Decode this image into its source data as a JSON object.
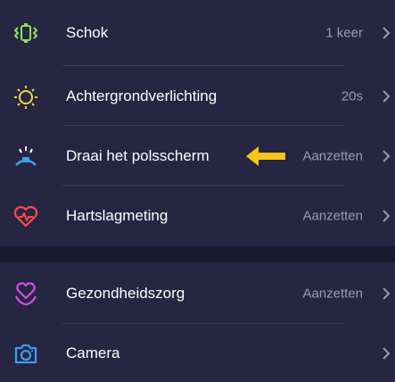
{
  "settings": {
    "group1": [
      {
        "icon": "shake-icon",
        "label": "Schok",
        "value": "1 keer"
      },
      {
        "icon": "sun-icon",
        "label": "Achtergrondverlichting",
        "value": "20s"
      },
      {
        "icon": "wrist-raise-icon",
        "label": "Draai het polsscherm",
        "value": "Aanzetten"
      },
      {
        "icon": "heart-rate-icon",
        "label": "Hartslagmeting",
        "value": "Aanzetten"
      }
    ],
    "group2": [
      {
        "icon": "health-heart-icon",
        "label": "Gezondheidszorg",
        "value": "Aanzetten"
      },
      {
        "icon": "camera-icon",
        "label": "Camera",
        "value": ""
      }
    ]
  },
  "annotation": {
    "icon": "arrow-left-icon",
    "color": "#f5c518"
  },
  "colors": {
    "background": "#262642",
    "section_gap": "#191930",
    "value_text": "#9a9ab5",
    "shake": "#8ee05a",
    "sun": "#f2d43a",
    "wrist": "#3ba0f0",
    "heart": "#ff4a4a",
    "health": "#d24ef0",
    "camera": "#3ba0f0"
  }
}
